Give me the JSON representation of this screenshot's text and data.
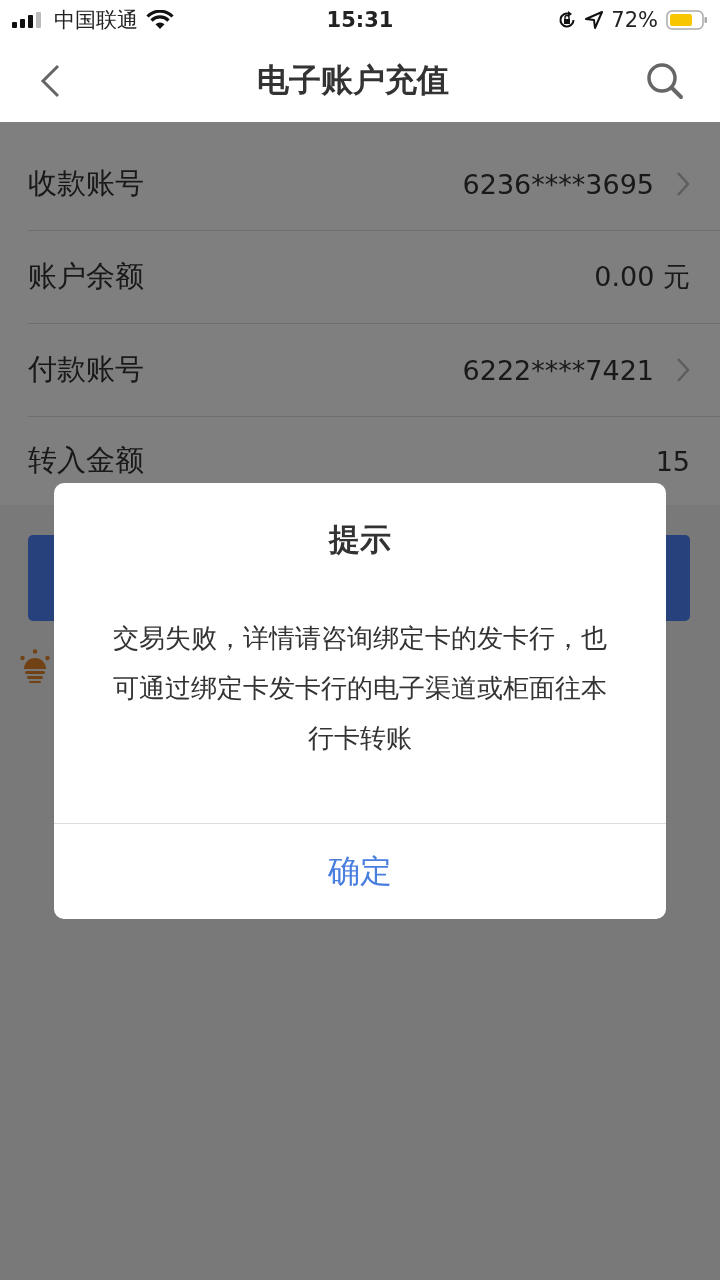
{
  "status_bar": {
    "carrier": "中国联通",
    "time": "15:31",
    "battery": "72%"
  },
  "nav": {
    "title": "电子账户充值"
  },
  "rows": [
    {
      "label": "收款账号",
      "value": "6236****3695",
      "kind": "link"
    },
    {
      "label": "账户余额",
      "value": "0.00 元",
      "kind": "plain"
    },
    {
      "label": "付款账号",
      "value": "6222****7421",
      "kind": "link"
    },
    {
      "label": "转入金额",
      "value": "15",
      "kind": "input"
    }
  ],
  "dialog": {
    "title": "提示",
    "message": "交易失败，详情请咨询绑定卡的发卡行，也可通过绑定卡发卡行的电子渠道或柜面往本行卡转账",
    "button": "确定"
  }
}
